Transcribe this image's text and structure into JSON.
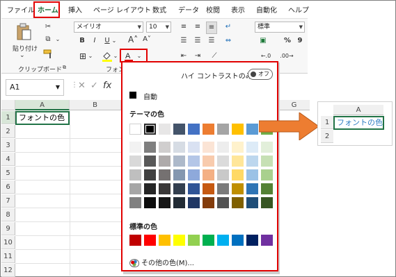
{
  "ribbon": {
    "tabs": [
      "ファイル",
      "ホーム",
      "挿入",
      "ページ レイアウト",
      "数式",
      "データ",
      "校閲",
      "表示",
      "自動化",
      "ヘルプ"
    ],
    "paste_label": "貼り付け",
    "clipboard_group": "クリップボード",
    "font_group": "フォン",
    "font_name": "メイリオ",
    "font_size": "10",
    "number_format": "標準",
    "percent_symbol": "%",
    "comma_symbol": "9"
  },
  "formula_bar": {
    "name_box": "A1",
    "fx": "fx"
  },
  "grid": {
    "columns": [
      "A",
      "B"
    ],
    "rows": [
      "1",
      "2",
      "3",
      "4",
      "5",
      "6",
      "7",
      "8",
      "9",
      "10",
      "11",
      "12"
    ],
    "a1_value": "フォントの色",
    "col_g": "G"
  },
  "palette": {
    "high_contrast_label": "ハイ コントラストのみ(H)",
    "toggle_text": "オフ",
    "automatic_label": "自動",
    "theme_header": "テーマの色",
    "standard_header": "標準の色",
    "more_colors": "その他の色(M)...",
    "theme_colors": [
      "#ffffff",
      "#000000",
      "#e7e6e6",
      "#44546a",
      "#4472c4",
      "#ed7d31",
      "#a5a5a5",
      "#ffc000",
      "#5b9bd5",
      "#70ad47"
    ],
    "theme_shades": [
      [
        "#f2f2f2",
        "#7f7f7f",
        "#d0cece",
        "#d6dce4",
        "#d9e1f2",
        "#fbe4d5",
        "#ededed",
        "#fff2cc",
        "#ddebf7",
        "#e2efda"
      ],
      [
        "#d9d9d9",
        "#595959",
        "#aeaaaa",
        "#adb9ca",
        "#b4c6e7",
        "#f8cbad",
        "#dbdbdb",
        "#ffe699",
        "#bdd7ee",
        "#c6e0b4"
      ],
      [
        "#bfbfbf",
        "#404040",
        "#757171",
        "#8497b0",
        "#8ea9db",
        "#f4b084",
        "#c9c9c9",
        "#ffd966",
        "#9bc2e6",
        "#a9d08e"
      ],
      [
        "#a6a6a6",
        "#262626",
        "#3a3838",
        "#333f4f",
        "#305496",
        "#c65911",
        "#7b7b7b",
        "#bf8f00",
        "#2f75b5",
        "#548235"
      ],
      [
        "#808080",
        "#0d0d0d",
        "#161616",
        "#222b35",
        "#203764",
        "#833c0c",
        "#525252",
        "#806000",
        "#1f4e78",
        "#375623"
      ]
    ],
    "standard_colors": [
      "#c00000",
      "#ff0000",
      "#ffc000",
      "#ffff00",
      "#92d050",
      "#00b050",
      "#00b0f0",
      "#0070c0",
      "#002060",
      "#7030a0"
    ]
  },
  "inset": {
    "column": "A",
    "rows": [
      "1",
      "2"
    ],
    "cell_value": "フォントの色",
    "text_color": "#2f7ec2"
  },
  "colors": {
    "accent_green": "#217346",
    "highlight_red": "#e10000",
    "arrow_orange": "#ed7d31"
  }
}
